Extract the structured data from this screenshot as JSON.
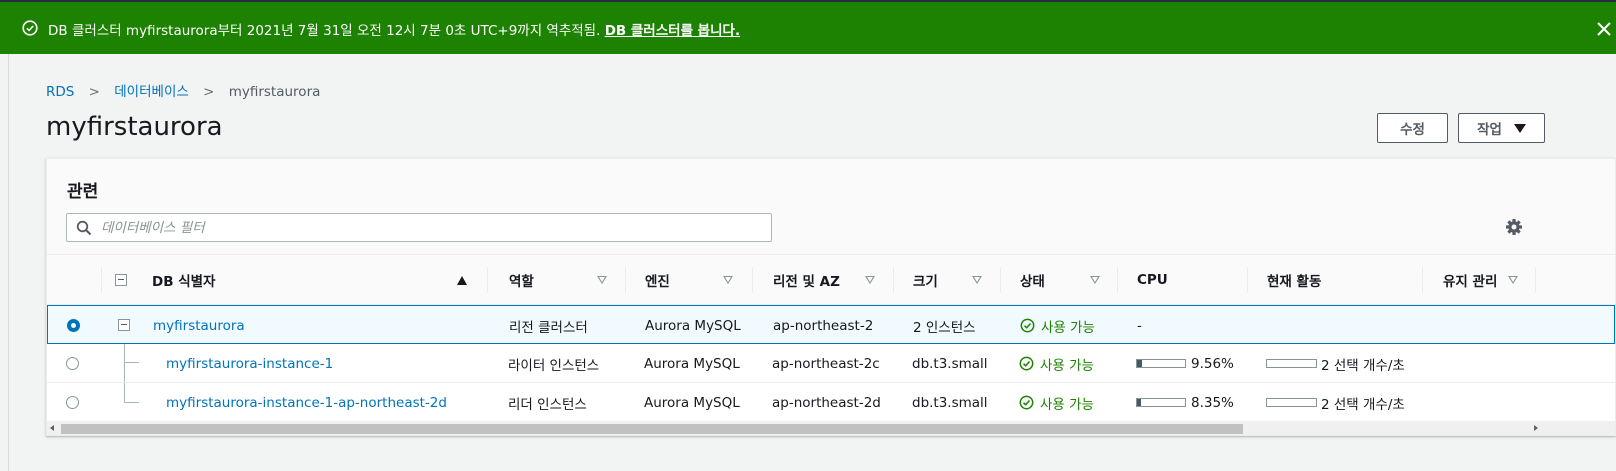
{
  "flash": {
    "message": "DB 클러스터 myfirstaurora부터 2021년 7월 31일 오전 12시 7분 0초 UTC+9까지 역추적됨.",
    "link": "DB 클러스터를 봅니다.",
    "success_icon": "check-circle-icon",
    "close_icon": "close-icon",
    "color": "#1d8102"
  },
  "breadcrumb": {
    "items": [
      "RDS",
      "데이터베이스",
      "myfirstaurora"
    ],
    "separator": ">"
  },
  "page": {
    "title": "myfirstaurora",
    "modify_label": "수정",
    "action_label": "작업"
  },
  "panel": {
    "title": "관련",
    "filter_placeholder": "데이터베이스 필터",
    "settings_icon": "gear-icon"
  },
  "table": {
    "columns": [
      "DB 식별자",
      "역할",
      "엔진",
      "리전 및 AZ",
      "크기",
      "상태",
      "CPU",
      "현재 활동",
      "유지 관리"
    ],
    "sort": {
      "column": "DB 식별자",
      "direction": "ascending"
    },
    "rows": [
      {
        "selected": true,
        "identifier": "myfirstaurora",
        "role": "리전 클러스터",
        "engine": "Aurora MySQL",
        "region": "ap-northeast-2",
        "size": "2 인스턴스",
        "status": "사용 가능",
        "cpu": "-",
        "cpu_percent": null,
        "activity": ""
      },
      {
        "selected": false,
        "identifier": "myfirstaurora-instance-1",
        "role": "라이터 인스턴스",
        "engine": "Aurora MySQL",
        "region": "ap-northeast-2c",
        "size": "db.t3.small",
        "status": "사용 가능",
        "cpu": "9.56%",
        "cpu_percent": 9.56,
        "activity": "2 선택 개수/초"
      },
      {
        "selected": false,
        "identifier": "myfirstaurora-instance-1-ap-northeast-2d",
        "role": "리더 인스턴스",
        "engine": "Aurora MySQL",
        "region": "ap-northeast-2d",
        "size": "db.t3.small",
        "status": "사용 가능",
        "cpu": "8.35%",
        "cpu_percent": 8.35,
        "activity": "2 선택 개수/초"
      }
    ]
  },
  "colors": {
    "link": "#0073bb",
    "status_ok": "#1d8102",
    "selected_row": "#f1faff"
  }
}
